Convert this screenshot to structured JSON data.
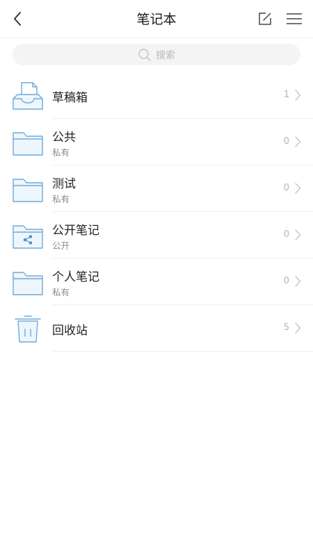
{
  "header": {
    "title": "笔记本"
  },
  "search": {
    "placeholder": "搜索"
  },
  "notebooks": [
    {
      "name": "草稿箱",
      "subtitle": "",
      "count": "1",
      "icon": "inbox-tray-icon"
    },
    {
      "name": "公共",
      "subtitle": "私有",
      "count": "0",
      "icon": "folder-icon"
    },
    {
      "name": "测试",
      "subtitle": "私有",
      "count": "0",
      "icon": "folder-icon"
    },
    {
      "name": "公开笔记",
      "subtitle": "公开",
      "count": "0",
      "icon": "shared-folder-icon"
    },
    {
      "name": "个人笔记",
      "subtitle": "私有",
      "count": "0",
      "icon": "folder-icon"
    },
    {
      "name": "回收站",
      "subtitle": "",
      "count": "5",
      "icon": "trash-icon"
    }
  ],
  "colors": {
    "icon_stroke": "#6ea8da",
    "icon_fill": "#eef6fd",
    "chevron": "#c4c4c4"
  }
}
